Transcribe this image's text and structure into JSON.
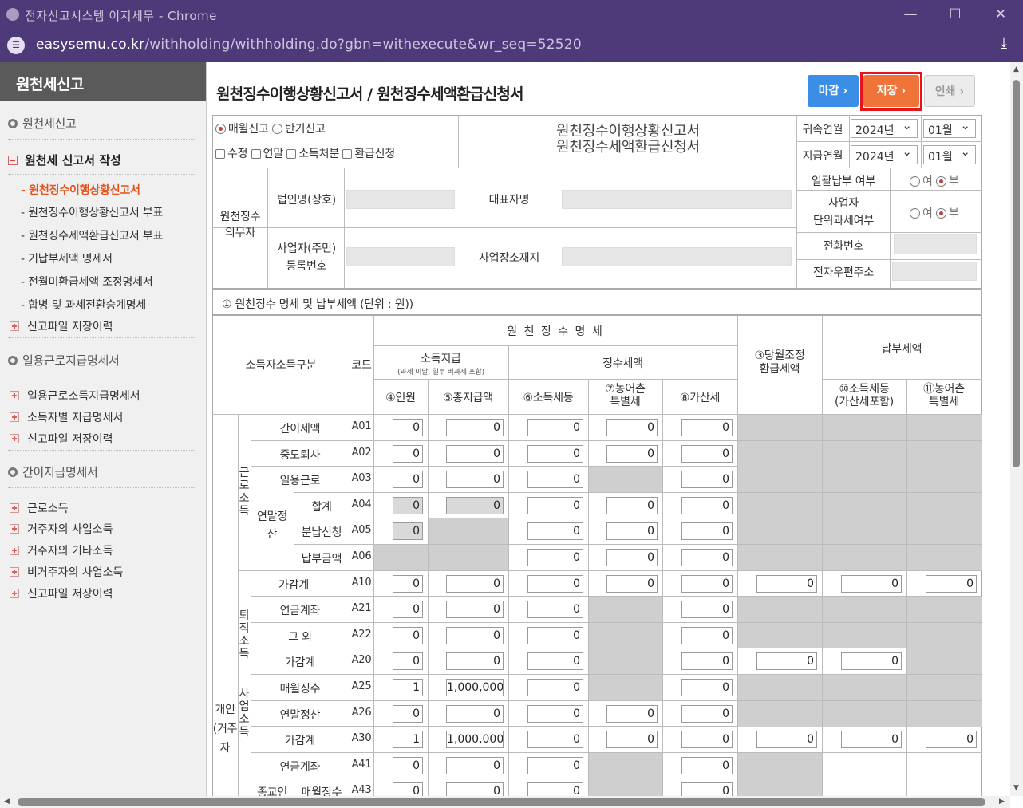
{
  "window": {
    "title": "전자신고시스템 이지세무 - Chrome"
  },
  "urlbar": {
    "host": "easysemu.co.kr",
    "path": "/withholding/withholding.do?gbn=withexecute&wr_seq=52520"
  },
  "sidebar": {
    "header": "원천세신고",
    "section1": "원천세신고",
    "group1": "원천세 신고서 작성",
    "items1": [
      "원천징수이행상황신고서",
      "원천징수이행상황신고서 부표",
      "원천징수세액환급신고서 부표",
      "기납부세액 명세서",
      "전월미환급세액 조정명세서",
      "합병 및 과세전환승계명세"
    ],
    "history1": "신고파일 저장이력",
    "section2": "일용근로지급명세서",
    "items2": [
      "일용근로소득지급명세서",
      "소득자별 지급명세서",
      "신고파일 저장이력"
    ],
    "section3": "간이지급명세서",
    "items3": [
      "근로소득",
      "거주자의 사업소득",
      "거주자의 기타소득",
      "비거주자의 사업소득",
      "신고파일 저장이력"
    ]
  },
  "page": {
    "title": "원천징수이행상황신고서 / 원천징수세액환급신청서"
  },
  "buttons": {
    "deadline": "마감 ›",
    "save": "저장 ›",
    "print": "인쇄 ›"
  },
  "form": {
    "report_type": {
      "monthly": "매월신고",
      "half": "반기신고",
      "selected": "매월신고"
    },
    "checks": {
      "amend": "수정",
      "yearend": "연말",
      "disposal": "소득처분",
      "refund": "환급신청"
    },
    "title_line1": "원천징수이행상황신고서",
    "title_line2": "원천징수세액환급신청서",
    "belong_label": "귀속연월",
    "pay_label": "지급연월",
    "belong_year": "2024년",
    "belong_month": "01월",
    "pay_year": "2024년",
    "pay_month": "01월",
    "agent_label": "원천징수\n의무자",
    "corp_name_label": "법인명(상호)",
    "rep_label": "대표자명",
    "bizno_label": "사업자(주민)\n등록번호",
    "addr_label": "사업장소재지",
    "lump_label": "일괄납부 여부",
    "unit_label": "사업자\n단위과세여부",
    "yes": "여",
    "no": "부",
    "phone_label": "전화번호",
    "email_label": "전자우편주소"
  },
  "section1_title": "① 원천징수 명세 및 납부세액 (단위 : 원))",
  "table": {
    "h_income_type": "소득자소득구분",
    "h_code": "코드",
    "h_detail": "원 천 징 수 명 세",
    "h_payment": "소득지급",
    "h_payment_note": "(과세 미달, 일부 비과세 포함)",
    "h_tax": "징수세액",
    "h_adjust": "③당월조정\n환급세액",
    "h_pay_tax": "납부세액",
    "c4": "④인원",
    "c5": "⑤총지급액",
    "c6": "⑥소득세등",
    "c7": "⑦농어촌\n특별세",
    "c8": "⑧가산세",
    "c10": "⑩소득세등\n(가산세포함)",
    "c11": "⑪농어촌\n특별세",
    "grp_individual": "개인(거주자",
    "grp_labor": "근로소득",
    "grp_retire": "퇴직소득",
    "grp_biz": "사업소득",
    "grp_yearend": "연말정산",
    "grp_religion": "종교인",
    "rows": [
      {
        "name": "간이세액",
        "code": "A01",
        "v4": "0",
        "v5": "0",
        "v6": "0",
        "v7": "0",
        "v8": "0"
      },
      {
        "name": "중도퇴사",
        "code": "A02",
        "v4": "0",
        "v5": "0",
        "v6": "0",
        "v7": "0",
        "v8": "0"
      },
      {
        "name": "일용근로",
        "code": "A03",
        "v4": "0",
        "v5": "0",
        "v6": "0",
        "v7": "",
        "v8": "0"
      },
      {
        "name": "합계",
        "code": "A04",
        "v4": "0",
        "v5": "0",
        "v6": "0",
        "v7": "0",
        "v8": "0"
      },
      {
        "name": "분납신청",
        "code": "A05",
        "v4": "0",
        "v5": "",
        "v6": "0",
        "v7": "0",
        "v8": "0"
      },
      {
        "name": "납부금액",
        "code": "A06",
        "v4": "",
        "v5": "",
        "v6": "0",
        "v7": "0",
        "v8": "0"
      },
      {
        "name": "가감계",
        "code": "A10",
        "v4": "0",
        "v5": "0",
        "v6": "0",
        "v7": "0",
        "v8": "0",
        "v9": "0",
        "v10": "0",
        "v11": "0"
      },
      {
        "name": "연금계좌",
        "code": "A21",
        "v4": "0",
        "v5": "0",
        "v6": "0",
        "v7": "",
        "v8": "0"
      },
      {
        "name": "그 외",
        "code": "A22",
        "v4": "0",
        "v5": "0",
        "v6": "0",
        "v7": "",
        "v8": "0"
      },
      {
        "name": "가감계",
        "code": "A20",
        "v4": "0",
        "v5": "0",
        "v6": "0",
        "v7": "",
        "v8": "0",
        "v9": "0",
        "v10": "0"
      },
      {
        "name": "매월징수",
        "code": "A25",
        "v4": "1",
        "v5": "1,000,000",
        "v6": "0",
        "v7": "",
        "v8": "0"
      },
      {
        "name": "연말정산",
        "code": "A26",
        "v4": "0",
        "v5": "0",
        "v6": "0",
        "v7": "0",
        "v8": "0"
      },
      {
        "name": "가감계",
        "code": "A30",
        "v4": "1",
        "v5": "1,000,000",
        "v6": "0",
        "v7": "0",
        "v8": "0",
        "v9": "0",
        "v10": "0",
        "v11": "0"
      },
      {
        "name": "연금계좌",
        "code": "A41",
        "v4": "0",
        "v5": "0",
        "v6": "0",
        "v7": "",
        "v8": "0"
      },
      {
        "name": "매월징수",
        "code": "A43",
        "v4": "0",
        "v5": "0",
        "v6": "0",
        "v7": "",
        "v8": "0"
      }
    ]
  }
}
